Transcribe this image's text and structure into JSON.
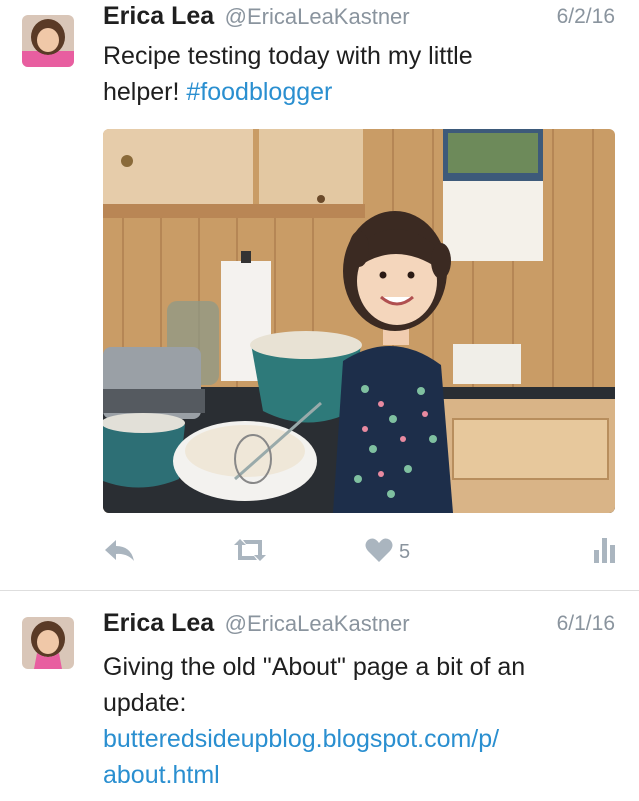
{
  "tweets": [
    {
      "name": "Erica Lea",
      "handle": "@EricaLeaKastner",
      "date": "6/2/16",
      "text_line1": "Recipe testing today with my little",
      "text_line2_prefix": "helper! ",
      "hashtag": "#foodblogger",
      "likes": "5",
      "icons": [
        "reply-icon",
        "retweet-icon",
        "like-icon",
        "analytics-icon"
      ]
    },
    {
      "name": "Erica Lea",
      "handle": "@EricaLeaKastner",
      "date": "6/1/16",
      "text_line1": "Giving the old \"About\" page a bit of an",
      "text_line2": "update:",
      "link_line1": "butteredsideupblog.blogspot.com/p/",
      "link_line2": "about.html"
    }
  ],
  "colors": {
    "link": "#2a8fd0",
    "muted": "#8a949e",
    "action_icon": "#aab5bf"
  }
}
